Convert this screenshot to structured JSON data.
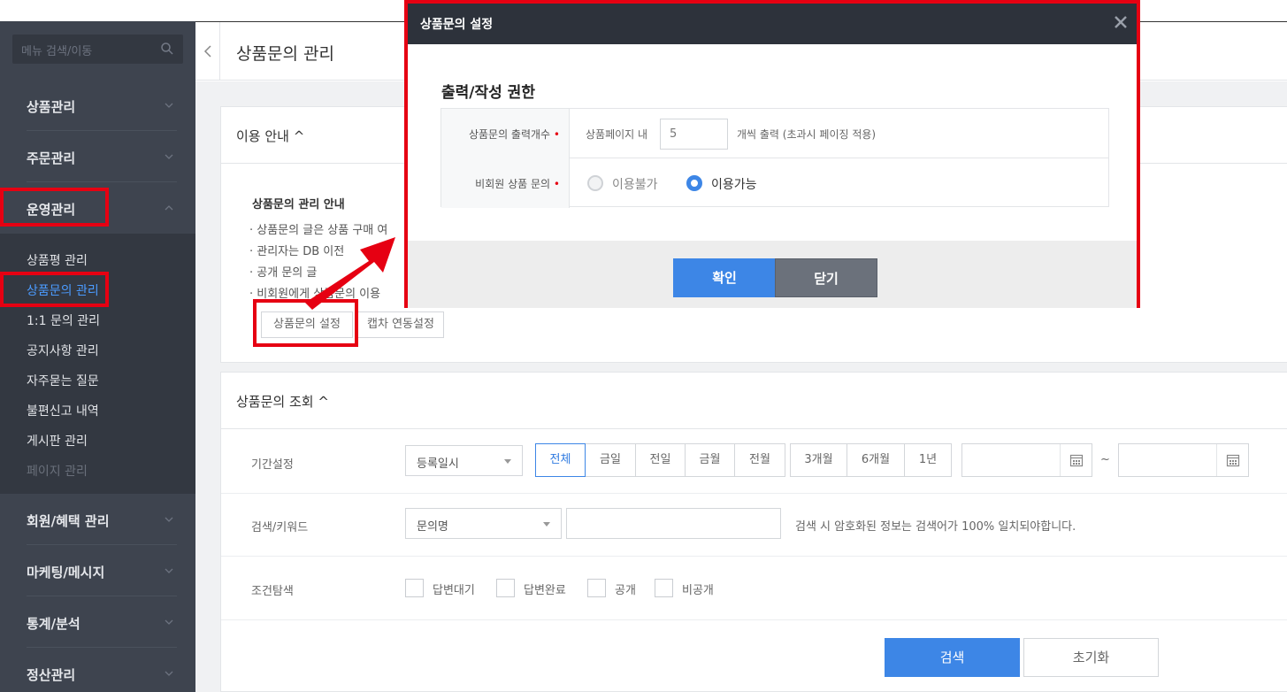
{
  "sidebar": {
    "search_placeholder": "메뉴 검색/이동",
    "groups": [
      {
        "label": "상품관리"
      },
      {
        "label": "주문관리"
      },
      {
        "label": "운영관리"
      },
      {
        "label": "회원/혜택 관리"
      },
      {
        "label": "마케팅/메시지"
      },
      {
        "label": "통계/분석"
      },
      {
        "label": "정산관리"
      }
    ],
    "sub_items": [
      {
        "label": "상품평 관리"
      },
      {
        "label": "상품문의 관리"
      },
      {
        "label": "1:1 문의 관리"
      },
      {
        "label": "공지사항 관리"
      },
      {
        "label": "자주묻는 질문"
      },
      {
        "label": "불편신고 내역"
      },
      {
        "label": "게시판 관리"
      },
      {
        "label": "페이지 관리"
      }
    ]
  },
  "header": {
    "title": "상품문의 관리"
  },
  "guide": {
    "section_title": "이용 안내 ^",
    "title": "상품문의 관리 안내",
    "lines": [
      "· 상품문의 글은 상품 구매 여",
      "· 관리자는 DB 이전",
      "· 공개 문의 글",
      "· 비회원에게 상품문의 이용 "
    ],
    "btn_settings": "상품문의 설정",
    "btn_captcha": "캡차 연동설정"
  },
  "search": {
    "section_title": "상품문의 조회 ^",
    "period_label": "기간설정",
    "period_select": "등록일시",
    "period_options": [
      "전체",
      "금일",
      "전일",
      "금월",
      "전월",
      "3개월",
      "6개월",
      "1년"
    ],
    "tilde": "~",
    "keyword_label": "검색/키워드",
    "keyword_select": "문의명",
    "keyword_hint": "검색 시 암호화된 정보는 검색어가 100% 일치되야합니다.",
    "condition_label": "조건탐색",
    "conditions": [
      "답변대기",
      "답변완료",
      "공개",
      "비공개"
    ],
    "btn_search": "검색",
    "btn_reset": "초기화"
  },
  "modal": {
    "title": "상품문의 설정",
    "subtitle": "출력/작성 권한",
    "row1_label": "상품문의 출력개수",
    "row1_prefix": "상품페이지 내",
    "row1_value": "5",
    "row1_suffix": "개씩 출력 (초과시 페이징 적용)",
    "row2_label": "비회원 상품 문의",
    "radio_off": "이용불가",
    "radio_on": "이용가능",
    "required_mark": "•",
    "btn_confirm": "확인",
    "btn_close": "닫기"
  },
  "colors": {
    "accent": "#3d86e6",
    "highlight": "#e60012",
    "sidebar": "#3e444f",
    "modal_header": "#2d323b"
  }
}
